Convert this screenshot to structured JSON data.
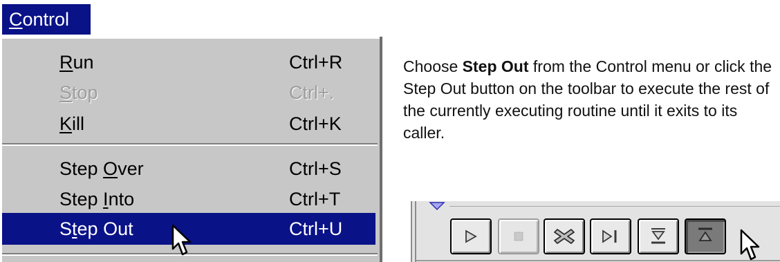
{
  "menu": {
    "title": "Control",
    "title_mnemonic": "C",
    "title_rest": "ontrol",
    "items": [
      {
        "label_pre": "",
        "mnemonic": "R",
        "label_post": "un",
        "shortcut": "Ctrl+R",
        "state": "enabled"
      },
      {
        "label_pre": "",
        "mnemonic": "S",
        "label_post": "top",
        "shortcut": "Ctrl+.",
        "state": "disabled"
      },
      {
        "label_pre": "",
        "mnemonic": "K",
        "label_post": "ill",
        "shortcut": "Ctrl+K",
        "state": "enabled"
      },
      {
        "label_pre": "Step ",
        "mnemonic": "O",
        "label_post": "ver",
        "shortcut": "Ctrl+S",
        "state": "enabled"
      },
      {
        "label_pre": "Step ",
        "mnemonic": "I",
        "label_post": "nto",
        "shortcut": "Ctrl+T",
        "state": "enabled"
      },
      {
        "label_pre": "S",
        "mnemonic": "t",
        "label_post": "ep Out",
        "shortcut": "Ctrl+U",
        "state": "selected"
      }
    ]
  },
  "description": {
    "prefix": "Choose ",
    "bold": "Step Out",
    "suffix": "  from the Control menu or click the Step Out button on the toolbar to execute the rest of the currently executing routine until it exits to its caller."
  },
  "toolbar": {
    "buttons": [
      {
        "icon": "play-icon",
        "state": "enabled"
      },
      {
        "icon": "stop-icon",
        "state": "disabled"
      },
      {
        "icon": "kill-icon",
        "state": "enabled"
      },
      {
        "icon": "step-over-icon",
        "state": "enabled"
      },
      {
        "icon": "step-into-icon",
        "state": "enabled"
      },
      {
        "icon": "step-out-icon",
        "state": "pressed"
      }
    ]
  },
  "colors": {
    "selection": "#0a1288",
    "menu_bg": "#c7c7c7",
    "disabled_text": "#9d9d9d"
  }
}
